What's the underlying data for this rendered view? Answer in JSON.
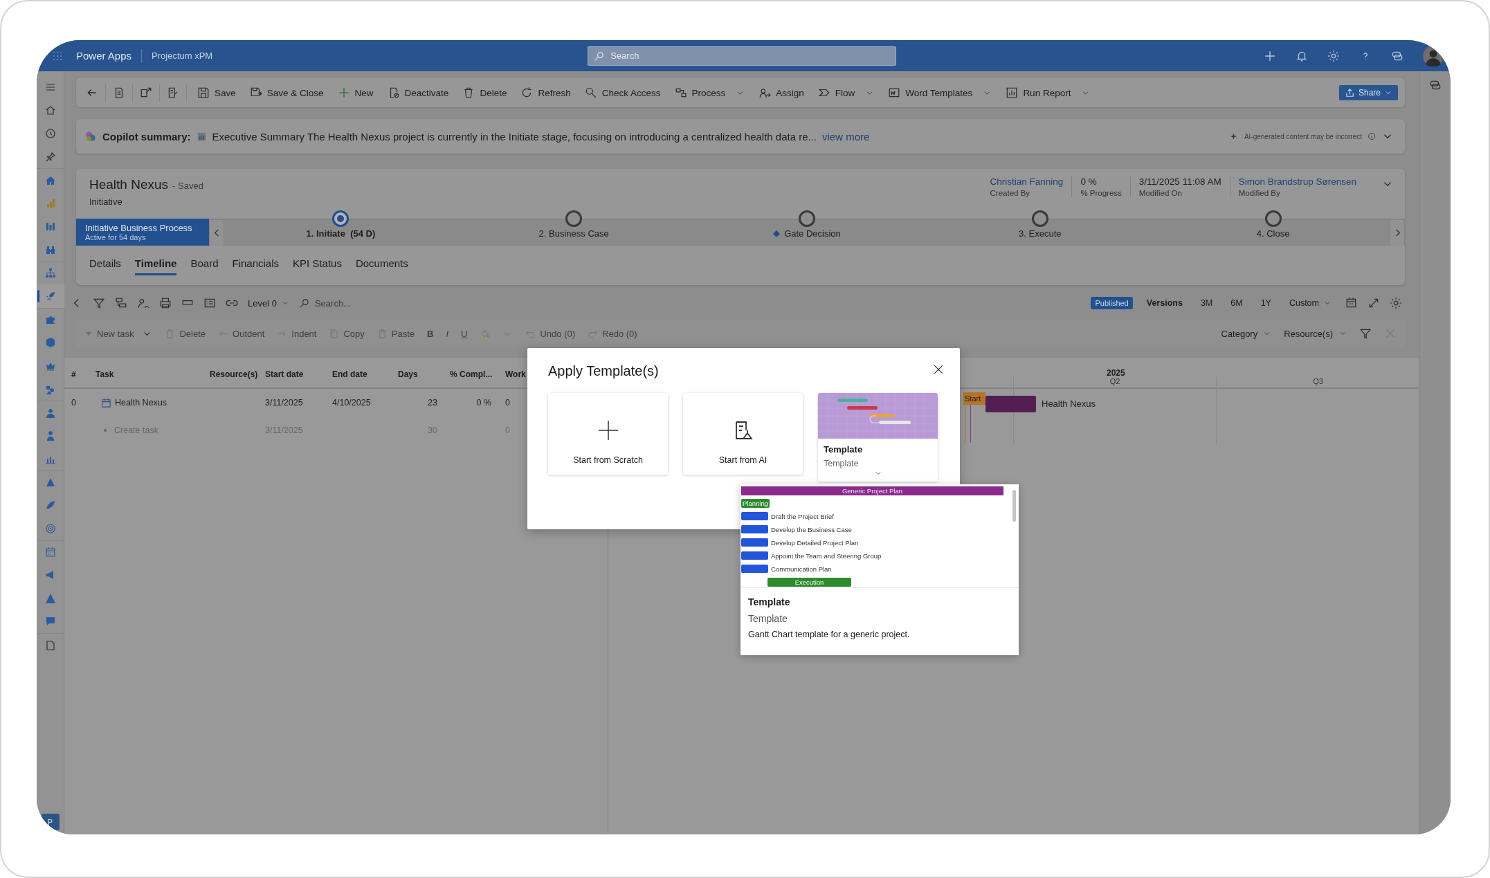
{
  "header": {
    "app_name": "Power Apps",
    "environment": "Projectum xPM",
    "search": {
      "placeholder": "Search"
    }
  },
  "sidebar": {
    "items": [
      {
        "selected": false
      },
      {
        "selected": false
      },
      {
        "selected": false
      },
      {
        "selected": false
      },
      {
        "selected": false
      },
      {
        "selected": false
      },
      {
        "selected": false
      },
      {
        "selected": false
      },
      {
        "selected": false
      },
      {
        "selected": true
      },
      {
        "selected": false
      },
      {
        "selected": false
      },
      {
        "selected": false
      },
      {
        "selected": false
      },
      {
        "selected": false
      },
      {
        "selected": false
      },
      {
        "selected": false
      },
      {
        "selected": false
      },
      {
        "selected": false
      },
      {
        "selected": false
      },
      {
        "selected": false
      },
      {
        "selected": false
      },
      {
        "selected": false
      },
      {
        "selected": false
      },
      {
        "selected": false
      }
    ],
    "badge": "P"
  },
  "command_bar": {
    "commands": [
      {
        "label": "Save",
        "kind": "save",
        "dropdown": false
      },
      {
        "label": "Save & Close",
        "kind": "save_close",
        "dropdown": false
      },
      {
        "label": "New",
        "kind": "new",
        "dropdown": false
      },
      {
        "label": "Deactivate",
        "kind": "deactivate",
        "dropdown": false
      },
      {
        "label": "Delete",
        "kind": "delete",
        "dropdown": false
      },
      {
        "label": "Refresh",
        "kind": "refresh",
        "dropdown": false
      },
      {
        "label": "Check Access",
        "kind": "check_access",
        "dropdown": false
      },
      {
        "label": "Process",
        "kind": "process",
        "dropdown": true
      },
      {
        "label": "Assign",
        "kind": "assign",
        "dropdown": false
      },
      {
        "label": "Flow",
        "kind": "flow",
        "dropdown": true
      },
      {
        "label": "Word Templates",
        "kind": "word",
        "dropdown": true
      },
      {
        "label": "Run Report",
        "kind": "report",
        "dropdown": true
      }
    ],
    "share": {
      "label": "Share"
    }
  },
  "copilot": {
    "label": "Copilot summary:",
    "summary": "Executive Summary The Health Nexus project is currently in the Initiate stage, focusing on introducing a centralized health data re...",
    "link": "view more",
    "disclaimer": "AI-generated content may be incorrect"
  },
  "record": {
    "title": "Health Nexus",
    "status": "- Saved",
    "entity": "Initiative",
    "fields": [
      {
        "value": "Christian Fanning",
        "label": "Created By",
        "kind": "link"
      },
      {
        "value": "0 %",
        "label": "% Progress",
        "kind": "text"
      },
      {
        "value": "3/11/2025 11:08 AM",
        "label": "Modified On",
        "kind": "text"
      },
      {
        "value": "Simon Brandstrup Sørensen",
        "label": "Modified By",
        "kind": "link"
      }
    ]
  },
  "process": {
    "name": "Initiative Business Process",
    "active": "Active for 54 days",
    "stages": [
      {
        "label": "1. Initiate",
        "duration": "(54 D)",
        "kind": "stage",
        "selected": true
      },
      {
        "label": "2. Business Case",
        "kind": "stage",
        "selected": false
      },
      {
        "label": "Gate Decision",
        "kind": "gate",
        "selected": false
      },
      {
        "label": "3. Execute",
        "kind": "stage",
        "selected": false
      },
      {
        "label": "4. Close",
        "kind": "stage",
        "selected": false
      }
    ]
  },
  "tabs": [
    {
      "label": "Details",
      "selected": false
    },
    {
      "label": "Timeline",
      "selected": true
    },
    {
      "label": "Board",
      "selected": false
    },
    {
      "label": "Financials",
      "selected": false
    },
    {
      "label": "KPI Status",
      "selected": false
    },
    {
      "label": "Documents",
      "selected": false
    }
  ],
  "timeline_toolbar": {
    "level": "Level 0",
    "search": {
      "placeholder": "Search..."
    },
    "status": "Published",
    "versions": "Versions",
    "ranges": [
      "3M",
      "6M",
      "1Y"
    ],
    "custom": "Custom"
  },
  "task_bar": {
    "actions": [
      {
        "label": "New task",
        "kind": "new",
        "disabled": true
      },
      {
        "label": "Delete",
        "kind": "delete",
        "disabled": true
      },
      {
        "label": "Outdent",
        "kind": "outdent",
        "disabled": true
      },
      {
        "label": "Indent",
        "kind": "indent",
        "disabled": true
      },
      {
        "label": "Copy",
        "kind": "copy",
        "disabled": true
      },
      {
        "label": "Paste",
        "kind": "paste",
        "disabled": true
      },
      {
        "label": "B",
        "kind": "bold",
        "disabled": true
      },
      {
        "label": "I",
        "kind": "italic",
        "disabled": true
      },
      {
        "label": "U",
        "kind": "underline",
        "disabled": true
      },
      {
        "label": "Undo (0)",
        "kind": "undo",
        "disabled": true
      },
      {
        "label": "Redo (0)",
        "kind": "redo",
        "disabled": true
      }
    ],
    "filters": [
      "Category",
      "Resource(s)"
    ]
  },
  "grid": {
    "columns": [
      "#",
      "Task",
      "Resource(s)",
      "Start date",
      "End date",
      "Days",
      "% Compl...",
      "Work"
    ],
    "rows": [
      {
        "number": "0",
        "task": "Health Nexus",
        "start": "3/11/2025",
        "end": "4/10/2025",
        "days": "23",
        "complete": "0 %",
        "work": "0",
        "kind": "summary"
      },
      {
        "task": "Create task",
        "start": "3/11/2025",
        "days": "30",
        "work": "0",
        "kind": "placeholder"
      }
    ]
  },
  "gantt": {
    "year": "2025",
    "quarters": [
      "Q2",
      "Q3"
    ],
    "bar": {
      "label": "Health Nexus"
    },
    "marker": "Start"
  },
  "dialog": {
    "title": "Apply Template(s)",
    "options": [
      {
        "kind": "scratch",
        "label": "Start from Scratch"
      },
      {
        "kind": "ai",
        "label": "Start from AI"
      },
      {
        "kind": "template",
        "title": "Template",
        "subtitle": "Template"
      }
    ]
  },
  "template_popup": {
    "preview": {
      "title": "Generic Project Plan",
      "rows": [
        {
          "kind": "phase",
          "label": "Planning"
        },
        {
          "kind": "task",
          "label": "Draft the Project Brief"
        },
        {
          "kind": "task",
          "label": "Develop the Business Case"
        },
        {
          "kind": "task",
          "label": "Develop Detailed Project Plan"
        },
        {
          "kind": "task",
          "label": "Appoint the Team and Steering Group"
        },
        {
          "kind": "task",
          "label": "Communication Plan"
        },
        {
          "kind": "phase",
          "label": "Execution"
        }
      ]
    },
    "title": "Template",
    "subtitle": "Template",
    "description": "Gantt Chart template for a generic project."
  }
}
